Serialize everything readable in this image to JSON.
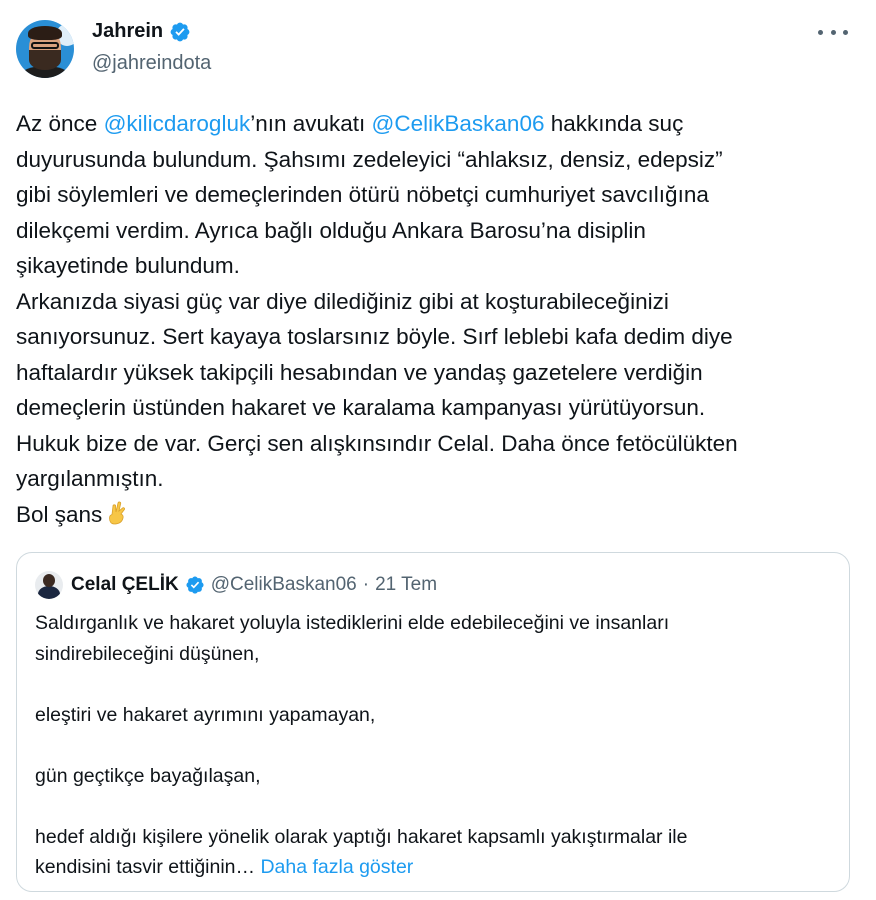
{
  "author": {
    "display_name": "Jahrein",
    "handle": "@jahreindota",
    "verified": true,
    "avatar_icon": "user-avatar"
  },
  "colors": {
    "link": "#1d9bf0",
    "verified_badge": "#1d9bf0",
    "secondary_text": "#536471",
    "border": "#cfd9de"
  },
  "tweet": {
    "lines": [
      {
        "parts": [
          {
            "text": "Az önce ",
            "type": "text"
          },
          {
            "text": "@kilicdarogluk",
            "type": "mention"
          },
          {
            "text": "’nın avukatı ",
            "type": "text"
          },
          {
            "text": "@CelikBaskan06",
            "type": "mention"
          },
          {
            "text": " hakkında suç",
            "type": "text"
          }
        ]
      },
      {
        "parts": [
          {
            "text": "duyurusunda bulundum. Şahsımı zedeleyici “ahlaksız, densiz, edepsiz”",
            "type": "text"
          }
        ]
      },
      {
        "parts": [
          {
            "text": "gibi söylemleri ve demeçlerinden ötürü nöbetçi cumhuriyet savcılığına",
            "type": "text"
          }
        ]
      },
      {
        "parts": [
          {
            "text": "dilekçemi verdim. Ayrıca bağlı olduğu Ankara Barosu’na disiplin",
            "type": "text"
          }
        ]
      },
      {
        "parts": [
          {
            "text": "şikayetinde bulundum.",
            "type": "text"
          }
        ]
      },
      {
        "parts": [
          {
            "text": "Arkanızda siyasi güç var diye dilediğiniz gibi at koşturabileceğinizi",
            "type": "text"
          }
        ]
      },
      {
        "parts": [
          {
            "text": "sanıyorsunuz. Sert kayaya toslarsınız böyle. Sırf leblebi kafa dedim diye",
            "type": "text"
          }
        ]
      },
      {
        "parts": [
          {
            "text": "haftalardır yüksek takipçili hesabından ve yandaş gazetelere verdiğin",
            "type": "text"
          }
        ]
      },
      {
        "parts": [
          {
            "text": "demeçlerin üstünden hakaret ve karalama kampanyası yürütüyorsun.",
            "type": "text"
          }
        ]
      },
      {
        "parts": [
          {
            "text": "Hukuk bize de var. Gerçi sen alışkınsındır Celal. Daha önce fetöcülükten",
            "type": "text"
          }
        ]
      },
      {
        "parts": [
          {
            "text": "yargılanmıştın.",
            "type": "text"
          }
        ]
      },
      {
        "parts": [
          {
            "text": "Bol şans",
            "type": "text"
          },
          {
            "text": "crossed-fingers-emoji",
            "type": "emoji"
          }
        ]
      }
    ]
  },
  "quoted": {
    "display_name": "Celal ÇELİK",
    "handle": "@CelikBaskan06",
    "separator": "·",
    "date": "21 Tem",
    "verified": true,
    "lines": [
      "Saldırganlık ve hakaret yoluyla istediklerini elde edebileceğini ve insanları",
      "sindirebileceğini düşünen,",
      "",
      "eleştiri ve hakaret ayrımını yapamayan,",
      "",
      "gün geçtikçe bayağılaşan,",
      "",
      "hedef aldığı kişilere yönelik olarak yaptığı hakaret kapsamlı yakıştırmalar ile"
    ],
    "last_line": "kendisini tasvir ettiğinin…",
    "show_more": "Daha fazla göster"
  }
}
